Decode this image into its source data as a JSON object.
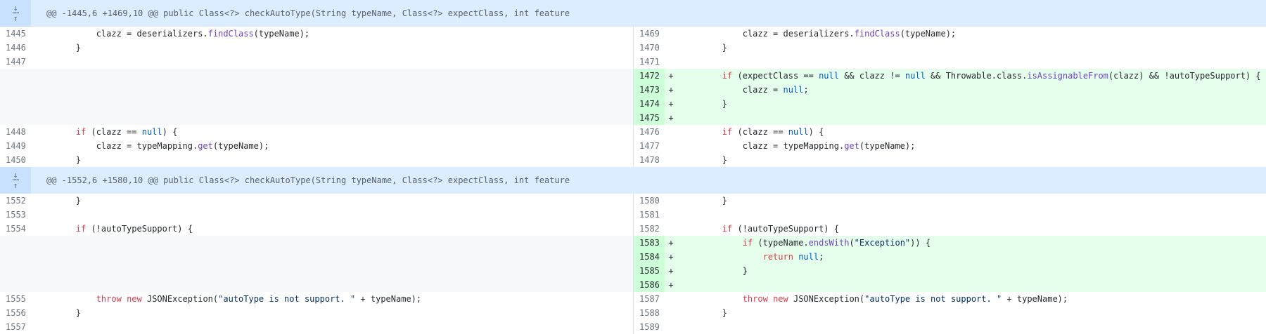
{
  "hunks": [
    {
      "header": "@@ -1445,6 +1469,10 @@ public Class<?> checkAutoType(String typeName, Class<?> expectClass, int feature",
      "rows": [
        {
          "left_num": "1445",
          "left_code": [
            [
              "",
              "            clazz = deserializers."
            ],
            [
              "fn",
              "findClass"
            ],
            [
              "",
              "(typeName);"
            ]
          ],
          "right_num": "1469",
          "right_code": [
            [
              "",
              "            clazz = deserializers."
            ],
            [
              "fn",
              "findClass"
            ],
            [
              "",
              "(typeName);"
            ]
          ],
          "added": false
        },
        {
          "left_num": "1446",
          "left_code": [
            [
              "",
              "        }"
            ]
          ],
          "right_num": "1470",
          "right_code": [
            [
              "",
              "        }"
            ]
          ],
          "added": false
        },
        {
          "left_num": "1447",
          "left_code": [
            [
              "",
              ""
            ]
          ],
          "right_num": "1471",
          "right_code": [
            [
              "",
              ""
            ]
          ],
          "added": false
        },
        {
          "left_num": "",
          "left_code": null,
          "right_num": "1472",
          "right_code": [
            [
              "",
              "        "
            ],
            [
              "kw",
              "if"
            ],
            [
              "",
              " (expectClass == "
            ],
            [
              "lit",
              "null"
            ],
            [
              "",
              " && clazz != "
            ],
            [
              "lit",
              "null"
            ],
            [
              "",
              " && Throwable.class."
            ],
            [
              "fn",
              "isAssignableFrom"
            ],
            [
              "",
              "(clazz) && !autoTypeSupport) {"
            ]
          ],
          "added": true
        },
        {
          "left_num": "",
          "left_code": null,
          "right_num": "1473",
          "right_code": [
            [
              "",
              "            clazz = "
            ],
            [
              "lit",
              "null"
            ],
            [
              "",
              ";"
            ]
          ],
          "added": true
        },
        {
          "left_num": "",
          "left_code": null,
          "right_num": "1474",
          "right_code": [
            [
              "",
              "        }"
            ]
          ],
          "added": true
        },
        {
          "left_num": "",
          "left_code": null,
          "right_num": "1475",
          "right_code": [
            [
              "",
              ""
            ]
          ],
          "added": true
        },
        {
          "left_num": "1448",
          "left_code": [
            [
              "",
              "        "
            ],
            [
              "kw",
              "if"
            ],
            [
              "",
              " (clazz == "
            ],
            [
              "lit",
              "null"
            ],
            [
              "",
              ") {"
            ]
          ],
          "right_num": "1476",
          "right_code": [
            [
              "",
              "        "
            ],
            [
              "kw",
              "if"
            ],
            [
              "",
              " (clazz == "
            ],
            [
              "lit",
              "null"
            ],
            [
              "",
              ") {"
            ]
          ],
          "added": false
        },
        {
          "left_num": "1449",
          "left_code": [
            [
              "",
              "            clazz = typeMapping."
            ],
            [
              "fn",
              "get"
            ],
            [
              "",
              "(typeName);"
            ]
          ],
          "right_num": "1477",
          "right_code": [
            [
              "",
              "            clazz = typeMapping."
            ],
            [
              "fn",
              "get"
            ],
            [
              "",
              "(typeName);"
            ]
          ],
          "added": false
        },
        {
          "left_num": "1450",
          "left_code": [
            [
              "",
              "        }"
            ]
          ],
          "right_num": "1478",
          "right_code": [
            [
              "",
              "        }"
            ]
          ],
          "added": false
        }
      ]
    },
    {
      "header": "@@ -1552,6 +1580,10 @@ public Class<?> checkAutoType(String typeName, Class<?> expectClass, int feature",
      "rows": [
        {
          "left_num": "1552",
          "left_code": [
            [
              "",
              "        }"
            ]
          ],
          "right_num": "1580",
          "right_code": [
            [
              "",
              "        }"
            ]
          ],
          "added": false
        },
        {
          "left_num": "1553",
          "left_code": [
            [
              "",
              ""
            ]
          ],
          "right_num": "1581",
          "right_code": [
            [
              "",
              ""
            ]
          ],
          "added": false
        },
        {
          "left_num": "1554",
          "left_code": [
            [
              "",
              "        "
            ],
            [
              "kw",
              "if"
            ],
            [
              "",
              " (!autoTypeSupport) {"
            ]
          ],
          "right_num": "1582",
          "right_code": [
            [
              "",
              "        "
            ],
            [
              "kw",
              "if"
            ],
            [
              "",
              " (!autoTypeSupport) {"
            ]
          ],
          "added": false
        },
        {
          "left_num": "",
          "left_code": null,
          "right_num": "1583",
          "right_code": [
            [
              "",
              "            "
            ],
            [
              "kw",
              "if"
            ],
            [
              "",
              " (typeName."
            ],
            [
              "fn",
              "endsWith"
            ],
            [
              "",
              "("
            ],
            [
              "str",
              "\"Exception\""
            ],
            [
              "",
              ")) {"
            ]
          ],
          "added": true
        },
        {
          "left_num": "",
          "left_code": null,
          "right_num": "1584",
          "right_code": [
            [
              "",
              "                "
            ],
            [
              "kw",
              "return"
            ],
            [
              "",
              " "
            ],
            [
              "lit",
              "null"
            ],
            [
              "",
              ";"
            ]
          ],
          "added": true
        },
        {
          "left_num": "",
          "left_code": null,
          "right_num": "1585",
          "right_code": [
            [
              "",
              "            }"
            ]
          ],
          "added": true
        },
        {
          "left_num": "",
          "left_code": null,
          "right_num": "1586",
          "right_code": [
            [
              "",
              ""
            ]
          ],
          "added": true
        },
        {
          "left_num": "1555",
          "left_code": [
            [
              "",
              "            "
            ],
            [
              "kw",
              "throw"
            ],
            [
              "",
              " "
            ],
            [
              "kw",
              "new"
            ],
            [
              "",
              " JSONException("
            ],
            [
              "str",
              "\"autoType is not support. \""
            ],
            [
              "",
              " + typeName);"
            ]
          ],
          "right_num": "1587",
          "right_code": [
            [
              "",
              "            "
            ],
            [
              "kw",
              "throw"
            ],
            [
              "",
              " "
            ],
            [
              "kw",
              "new"
            ],
            [
              "",
              " JSONException("
            ],
            [
              "str",
              "\"autoType is not support. \""
            ],
            [
              "",
              " + typeName);"
            ]
          ],
          "added": false
        },
        {
          "left_num": "1556",
          "left_code": [
            [
              "",
              "        }"
            ]
          ],
          "right_num": "1588",
          "right_code": [
            [
              "",
              "        }"
            ]
          ],
          "added": false
        },
        {
          "left_num": "1557",
          "left_code": [
            [
              "",
              ""
            ]
          ],
          "right_num": "1589",
          "right_code": [
            [
              "",
              ""
            ]
          ],
          "added": false
        }
      ]
    }
  ],
  "added_marker": "+",
  "icons": {
    "expand": "expand-up-down-icon"
  },
  "colors": {
    "hunk_bg": "#dbedff",
    "added_bg": "#e6ffed",
    "added_num_bg": "#cdffd8",
    "empty_bg": "#f6f8fa"
  }
}
